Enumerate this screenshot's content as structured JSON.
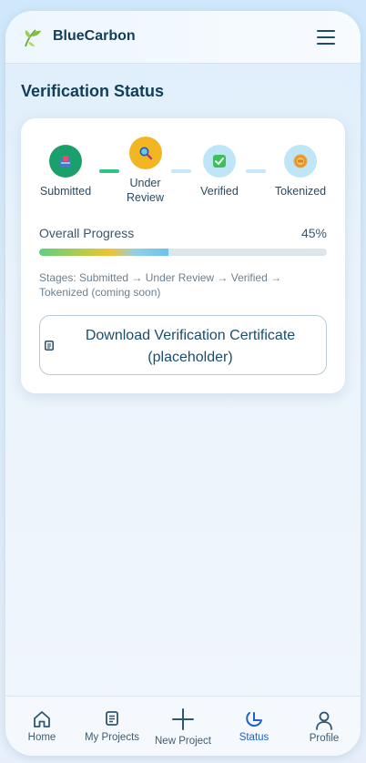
{
  "app": {
    "brand": "BlueCarbon"
  },
  "page": {
    "title": "Verification Status"
  },
  "stages": [
    {
      "label": "Submitted",
      "color": "#1aa06a"
    },
    {
      "label": "Under\nReview",
      "color": "#f2b622"
    },
    {
      "label": "Verified",
      "color": "#bfe6f7"
    },
    {
      "label": "Tokenized",
      "color": "#bfe6f7"
    }
  ],
  "progress": {
    "label": "Overall Progress",
    "percent_text": "45%",
    "value": 0.45
  },
  "stages_note": "Stages: Submitted → Under Review → Verified → Tokenized (coming soon)",
  "download_button": {
    "label": "Download Verification Certificate (placeholder)"
  },
  "nav": [
    {
      "label": "Home",
      "icon": "home-icon"
    },
    {
      "label": "My Projects",
      "icon": "projects-icon"
    },
    {
      "label": "New Project",
      "icon": "plus-icon"
    },
    {
      "label": "Status",
      "icon": "status-icon",
      "active": true
    },
    {
      "label": "Profile",
      "icon": "profile-icon"
    }
  ],
  "colors": {
    "accent": "#1f5fc9",
    "brand_text": "#123d57"
  }
}
